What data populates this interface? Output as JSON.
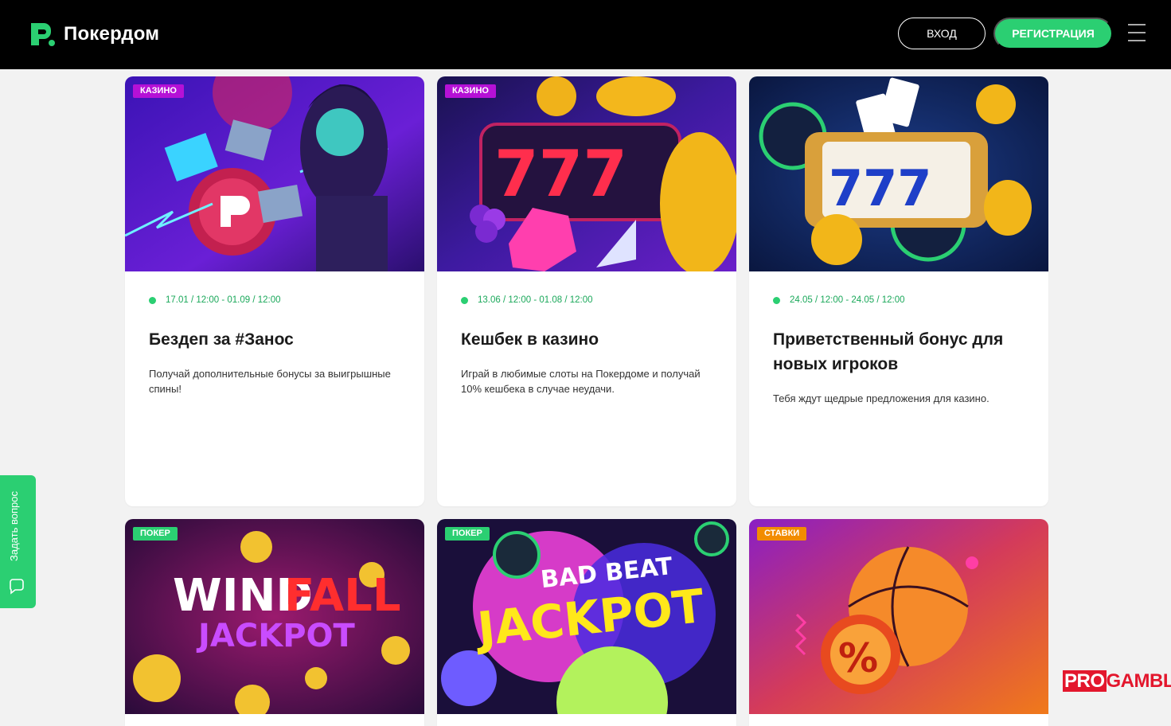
{
  "header": {
    "logo_text": "Покердом",
    "login_label": "ВХОД",
    "register_label": "РЕГИСТРАЦИЯ",
    "menu_icon": "hamburger-menu-icon"
  },
  "colors": {
    "accent": "#2bcf72",
    "casino_tag": "#b511d6",
    "poker_tag": "#2bcf72",
    "bets_tag": "#f28c00",
    "header_bg": "#000000"
  },
  "promos": [
    {
      "tag": "КАЗИНО",
      "date": "17.01 / 12:00 - 01.09 / 12:00",
      "title": "Бездеп за #Занос",
      "description": "Получай дополнительные бонусы за выигрышные спины!"
    },
    {
      "tag": "КАЗИНО",
      "date": "13.06 / 12:00 - 01.08 / 12:00",
      "title": "Кешбек в казино",
      "description": "Играй в любимые слоты на Покердоме и получай 10% кешбека в случае неудачи."
    },
    {
      "tag": "КАЗИНО",
      "date": "24.05 / 12:00 - 24.05 / 12:00",
      "title": "Приветственный бонус для новых игроков",
      "description": "Тебя ждут щедрые предложения для казино."
    },
    {
      "tag": "ПОКЕР",
      "image_text_1": "WIND",
      "image_text_2": "FALL",
      "image_text_3": "JACKPOT"
    },
    {
      "tag": "ПОКЕР",
      "image_text_1": "BAD BEAT",
      "image_text_2": "JACKPOT"
    },
    {
      "tag": "СТАВКИ",
      "image_text_1": "%"
    }
  ],
  "side_tab": {
    "label": "Задать вопрос",
    "icon": "chat-bubble-icon"
  },
  "watermark": {
    "part1": "PRO",
    "part2": "GAMBLER"
  }
}
